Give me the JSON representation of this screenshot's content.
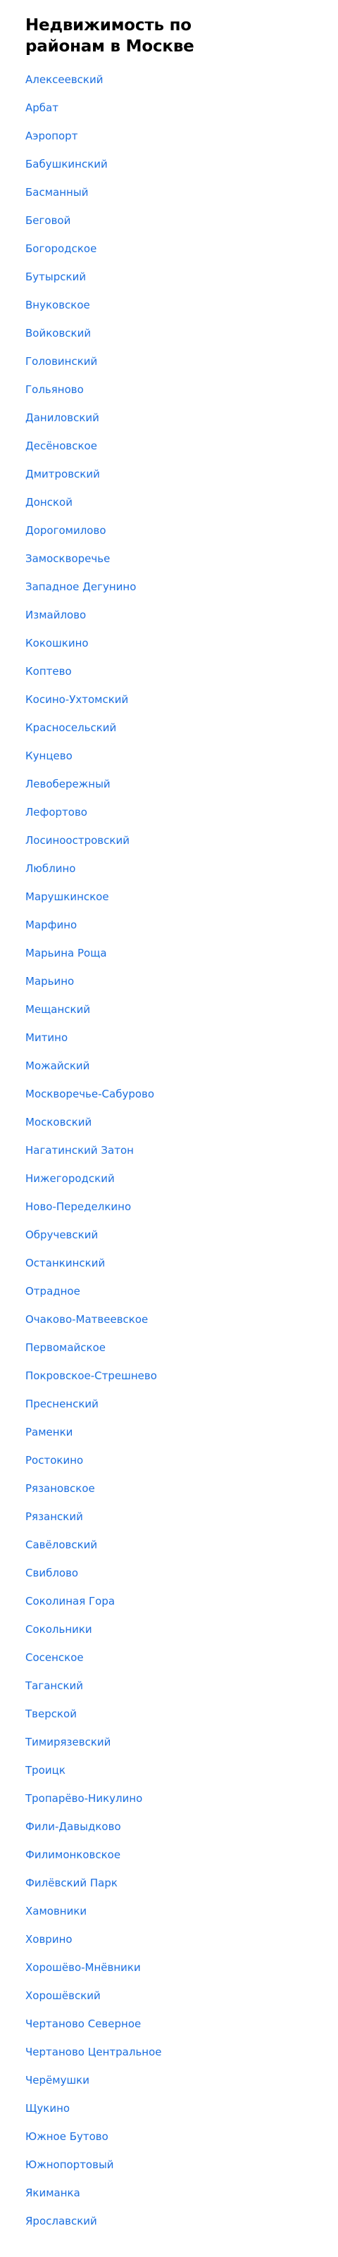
{
  "page": {
    "title": "Недвижимость по районам в Москве",
    "link_color": "#1a6ee0"
  },
  "districts": [
    "Алексеевский",
    "Арбат",
    "Аэропорт",
    "Бабушкинский",
    "Басманный",
    "Беговой",
    "Богородское",
    "Бутырский",
    "Внуковское",
    "Войковский",
    "Головинский",
    "Гольяново",
    "Даниловский",
    "Десёновское",
    "Дмитровский",
    "Донской",
    "Дорогомилово",
    "Замоскворечье",
    "Западное Дегунино",
    "Измайлово",
    "Кокошкино",
    "Коптево",
    "Косино-Ухтомский",
    "Красносельский",
    "Кунцево",
    "Левобережный",
    "Лефортово",
    "Лосиноостровский",
    "Люблино",
    "Марушкинское",
    "Марфино",
    "Марьина Роща",
    "Марьино",
    "Мещанский",
    "Митино",
    "Можайский",
    "Москворечье-Сабурово",
    "Московский",
    "Нагатинский Затон",
    "Нижегородский",
    "Ново-Переделкино",
    "Обручевский",
    "Останкинский",
    "Отрадное",
    "Очаково-Матвеевское",
    "Первомайское",
    "Покровское-Стрешнево",
    "Пресненский",
    "Раменки",
    "Ростокино",
    "Рязановское",
    "Рязанский",
    "Савёловский",
    "Свиблово",
    "Соколиная Гора",
    "Сокольники",
    "Сосенское",
    "Таганский",
    "Тверской",
    "Тимирязевский",
    "Троицк",
    "Тропарёво-Никулино",
    "Фили-Давыдково",
    "Филимонковское",
    "Филёвский Парк",
    "Хамовники",
    "Ховрино",
    "Хорошёво-Мнёвники",
    "Хорошёвский",
    "Чертаново Северное",
    "Чертаново Центральное",
    "Черёмушки",
    "Щукино",
    "Южное Бутово",
    "Южнопортовый",
    "Якиманка",
    "Ярославский"
  ]
}
